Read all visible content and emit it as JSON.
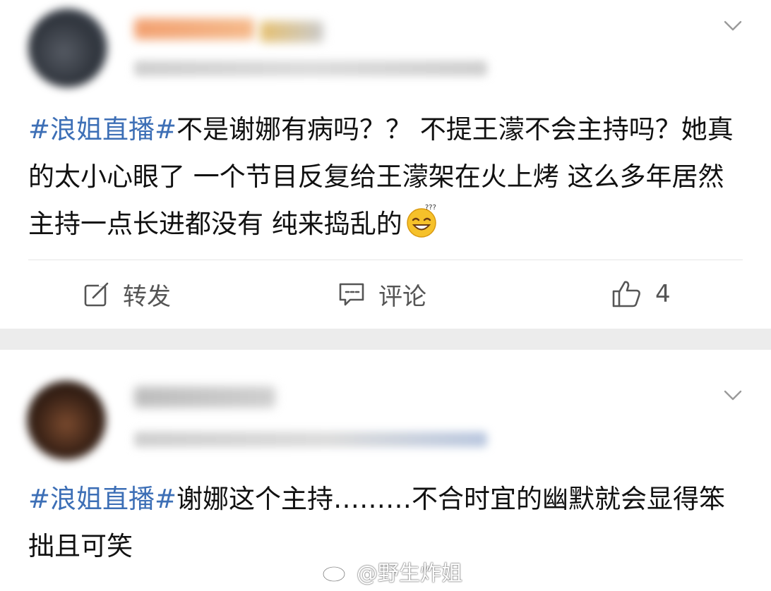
{
  "posts": [
    {
      "text_hashtag": "#浪姐直播#",
      "text_body": "不是谢娜有病吗？？ 不提王濛不会主持吗？她真的太小心眼了 一个节目反复给王濛架在火上烤 这么多年居然主持一点长进都没有 纯来捣乱的",
      "emoji": "dizzy-smile-emoji",
      "actions": {
        "repost": "转发",
        "comment": "评论",
        "like_count": "4"
      }
    },
    {
      "text_hashtag": "#浪姐直播#",
      "text_body": "谢娜这个主持………不合时宜的幽默就会显得笨拙且可笑"
    }
  ],
  "watermark": {
    "icon": "weibo-icon",
    "text": "@野生炸姐"
  },
  "colors": {
    "hashtag": "#3d6fb6",
    "separator": "#ececec",
    "icon_gray": "#555555"
  }
}
